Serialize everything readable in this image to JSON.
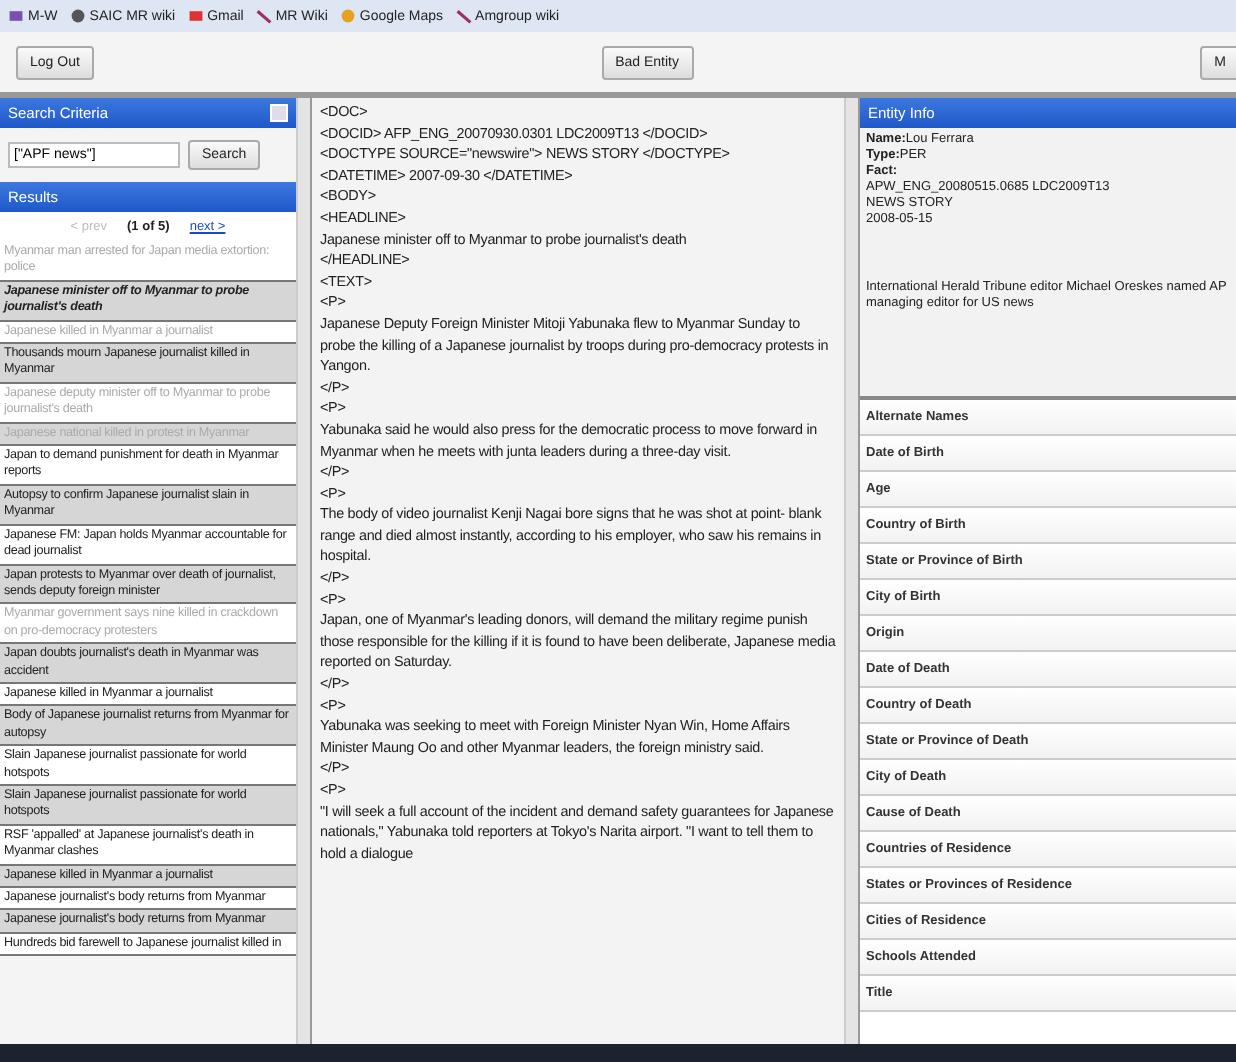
{
  "bookmarks": [
    {
      "label": "M-W",
      "kind": "book"
    },
    {
      "label": "SAIC MR wiki",
      "kind": "globe"
    },
    {
      "label": "Gmail",
      "kind": "mail"
    },
    {
      "label": "MR Wiki",
      "kind": "wiki"
    },
    {
      "label": "Google Maps",
      "kind": "pin"
    },
    {
      "label": "Amgroup wiki",
      "kind": "wiki"
    }
  ],
  "toolbar": {
    "logout": "Log Out",
    "bad_entity": "Bad Entity",
    "cut_button": "M"
  },
  "search": {
    "title": "Search Criteria",
    "value": "[\"APF news\"]",
    "button": "Search"
  },
  "results": {
    "title": "Results",
    "prev": "< prev",
    "page": "(1 of 5)",
    "next": "next >",
    "items": [
      {
        "text": "Myanmar man arrested for Japan media extortion: police",
        "kind": "dimmed",
        "selected": false
      },
      {
        "text": "Japanese minister off to Myanmar to probe journalist's death",
        "kind": "shaded",
        "selected": true
      },
      {
        "text": "Japanese killed in Myanmar a journalist",
        "kind": "dimmed",
        "selected": false
      },
      {
        "text": "Thousands mourn Japanese journalist killed in Myanmar",
        "kind": "shaded",
        "selected": false
      },
      {
        "text": "Japanese deputy minister off to Myanmar to probe journalist's death",
        "kind": "dimmed",
        "selected": false
      },
      {
        "text": "Japanese national killed in protest in Myanmar",
        "kind": "dimshaded",
        "selected": false
      },
      {
        "text": "Japan to demand punishment for death in Myanmar reports",
        "kind": "plain",
        "selected": false
      },
      {
        "text": "Autopsy to confirm Japanese journalist slain in Myanmar",
        "kind": "shaded",
        "selected": false
      },
      {
        "text": "Japanese FM: Japan holds Myanmar accountable for dead journalist",
        "kind": "plain",
        "selected": false
      },
      {
        "text": "Japan protests to Myanmar over death of journalist, sends deputy foreign minister",
        "kind": "shaded",
        "selected": false
      },
      {
        "text": "Myanmar government says nine killed in crackdown on pro-democracy protesters",
        "kind": "dimmed",
        "selected": false
      },
      {
        "text": "Japan doubts journalist's death in Myanmar was accident",
        "kind": "shaded",
        "selected": false
      },
      {
        "text": "Japanese killed in Myanmar a journalist",
        "kind": "plain",
        "selected": false
      },
      {
        "text": "Body of Japanese journalist returns from Myanmar for autopsy",
        "kind": "shaded",
        "selected": false
      },
      {
        "text": "Slain Japanese journalist passionate for world hotspots",
        "kind": "plain",
        "selected": false
      },
      {
        "text": "Slain Japanese journalist passionate for world hotspots",
        "kind": "shaded",
        "selected": false
      },
      {
        "text": "RSF 'appalled' at Japanese journalist's death in Myanmar clashes",
        "kind": "plain",
        "selected": false
      },
      {
        "text": "Japanese killed in Myanmar a journalist",
        "kind": "shaded",
        "selected": false
      },
      {
        "text": "Japanese journalist's body returns from Myanmar",
        "kind": "plain",
        "selected": false
      },
      {
        "text": "Japanese journalist's body returns from Myanmar",
        "kind": "shaded",
        "selected": false
      },
      {
        "text": "Hundreds bid farewell to Japanese journalist killed in",
        "kind": "plain",
        "selected": false
      }
    ]
  },
  "document": [
    "<DOC>",
    "<DOCID> AFP_ENG_20070930.0301 LDC2009T13 </DOCID>",
    "<DOCTYPE SOURCE=\"newswire\"> NEWS STORY </DOCTYPE>",
    "<DATETIME> 2007-09-30 </DATETIME>",
    "<BODY>",
    "<HEADLINE>",
    "Japanese minister off to Myanmar to probe journalist's death",
    "</HEADLINE>",
    "<TEXT>",
    "<P>",
    "Japanese Deputy Foreign Minister Mitoji Yabunaka flew to Myanmar Sunday to probe the killing of a Japanese journalist by troops during pro-democracy protests in Yangon.",
    "</P>",
    "<P>",
    "Yabunaka said he would also press for the democratic process to move forward in Myanmar when he meets with junta leaders during a three-day visit.",
    "</P>",
    "<P>",
    "The body of video journalist Kenji Nagai bore signs that he was shot at point- blank range and died almost instantly, according to his employer, who saw his remains in hospital.",
    "</P>",
    "<P>",
    "Japan, one of Myanmar's leading donors, will demand the military regime punish those responsible for the killing if it is found to have been deliberate, Japanese media reported on Saturday.",
    "</P>",
    "<P>",
    "Yabunaka was seeking to meet with Foreign Minister Nyan Win, Home Affairs Minister Maung Oo and other Myanmar leaders, the foreign ministry said.",
    "</P>",
    "<P>",
    "\"I will seek a full account of the incident and demand safety guarantees for Japanese nationals,\" Yabunaka told reporters at Tokyo's Narita airport. \"I want to tell them to hold a dialogue"
  ],
  "entity": {
    "title": "Entity Info",
    "name_label": "Name:",
    "name": "Lou Ferrara",
    "type_label": "Type:",
    "type": "PER",
    "fact_label": "Fact:",
    "fact_lines": [
      "APW_ENG_20080515.0685 LDC2009T13",
      "NEWS STORY",
      "2008-05-15"
    ],
    "summary": "International Herald Tribune editor Michael Oreskes named AP managing editor for US news",
    "fields": [
      "Alternate Names",
      "Date of Birth",
      "Age",
      "Country of Birth",
      "State or Province of Birth",
      "City of Birth",
      "Origin",
      "Date of Death",
      "Country of Death",
      "State or Province of Death",
      "City of Death",
      "Cause of Death",
      "Countries of Residence",
      "States or Provinces of Residence",
      "Cities of Residence",
      "Schools Attended",
      "Title"
    ]
  }
}
